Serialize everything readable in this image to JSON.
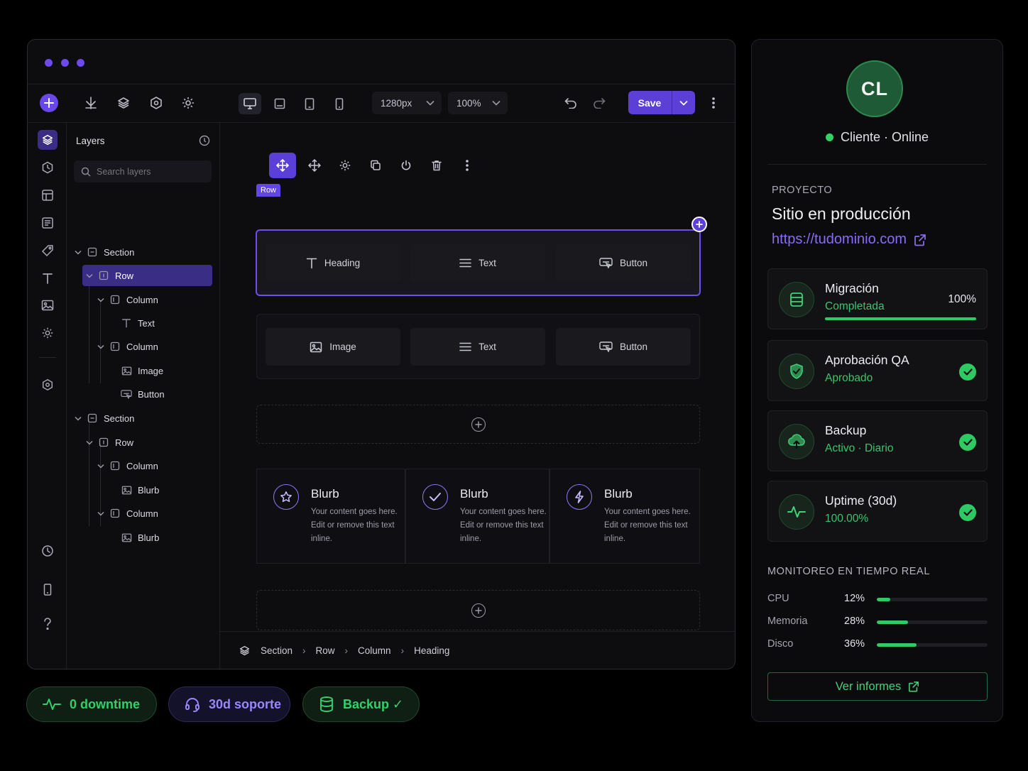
{
  "toolbar": {
    "width_value": "1280px",
    "zoom_value": "100%",
    "save_label": "Save"
  },
  "layers": {
    "title": "Layers",
    "search_placeholder": "Search layers",
    "tree": [
      {
        "label": "Section",
        "icon": "section-icon",
        "expanded": true
      },
      {
        "label": "Row",
        "icon": "row-icon",
        "expanded": true,
        "selected": true
      },
      {
        "label": "Column",
        "icon": "column-icon",
        "expanded": true
      },
      {
        "label": "Text",
        "icon": "text-icon"
      },
      {
        "label": "Column",
        "icon": "column-icon",
        "expanded": true
      },
      {
        "label": "Image",
        "icon": "image-icon"
      },
      {
        "label": "Button",
        "icon": "button-icon"
      },
      {
        "label": "Section",
        "icon": "section-icon",
        "expanded": true
      },
      {
        "label": "Row",
        "icon": "row-icon",
        "expanded": true
      },
      {
        "label": "Column",
        "icon": "column-icon",
        "expanded": true
      },
      {
        "label": "Blurb",
        "icon": "blurb-icon"
      },
      {
        "label": "Column",
        "icon": "column-icon",
        "expanded": true
      },
      {
        "label": "Blurb",
        "icon": "blurb-icon"
      }
    ]
  },
  "canvas": {
    "row_tag": "Row",
    "row1": [
      "Heading",
      "Text",
      "Button"
    ],
    "row2": [
      "Image",
      "Text",
      "Button"
    ],
    "blurbs": [
      {
        "title": "Blurb",
        "text": "Your content goes here. Edit or remove this text inline.",
        "icon": "star-icon"
      },
      {
        "title": "Blurb",
        "text": "Your content goes here. Edit or remove this text inline.",
        "icon": "check-icon"
      },
      {
        "title": "Blurb",
        "text": "Your content goes here. Edit or remove this text inline.",
        "icon": "bolt-icon"
      }
    ]
  },
  "breadcrumb": [
    "Section",
    "Row",
    "Column",
    "Heading"
  ],
  "client": {
    "initials": "CL",
    "status": "Cliente · Online"
  },
  "project": {
    "label": "PROYECTO",
    "name": "Sitio en producción",
    "url": "https://tudominio.com"
  },
  "cards": [
    {
      "title": "Migración",
      "sub": "Completada",
      "pct": "100%",
      "progress": 1.0,
      "icon": "database-icon"
    },
    {
      "title": "Aprobación QA",
      "sub": "Aprobado",
      "icon": "shield-check-icon"
    },
    {
      "title": "Backup",
      "sub": "Activo · Diario",
      "icon": "cloud-upload-icon"
    },
    {
      "title": "Uptime (30d)",
      "sub": "100.00%",
      "icon": "pulse-icon"
    }
  ],
  "monitor": {
    "title": "MONITOREO EN TIEMPO REAL",
    "rows": [
      {
        "label": "CPU",
        "pct": "12%",
        "value": 0.12
      },
      {
        "label": "Memoria",
        "pct": "28%",
        "value": 0.28
      },
      {
        "label": "Disco",
        "pct": "36%",
        "value": 0.36
      }
    ]
  },
  "report_label": "Ver informes",
  "pills": [
    {
      "label": "0 downtime",
      "icon": "pulse-icon"
    },
    {
      "label": "30d soporte",
      "icon": "headset-icon"
    },
    {
      "label": "Backup ✓",
      "icon": "database-icon"
    }
  ],
  "colors": {
    "accent": "#6d4ef0",
    "success": "#2fc966",
    "link": "#8a6df5"
  }
}
